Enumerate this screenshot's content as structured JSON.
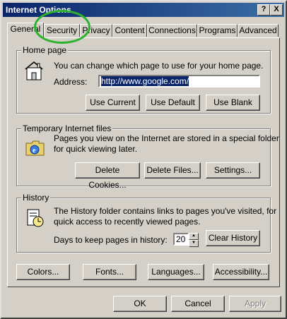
{
  "window": {
    "title": "Internet Options",
    "help_glyph": "?",
    "close_glyph": "X"
  },
  "tabs": [
    {
      "label": "General"
    },
    {
      "label": "Security"
    },
    {
      "label": "Privacy"
    },
    {
      "label": "Content"
    },
    {
      "label": "Connections"
    },
    {
      "label": "Programs"
    },
    {
      "label": "Advanced"
    }
  ],
  "home_page": {
    "title": "Home page",
    "description": "You can change which page to use for your home page.",
    "address_label": "Address:",
    "address_value": "http://www.google.com/",
    "use_current": "Use Current",
    "use_default": "Use Default",
    "use_blank": "Use Blank"
  },
  "temp_files": {
    "title": "Temporary Internet files",
    "description_line1": "Pages you view on the Internet are stored in a special folder",
    "description_line2": "for quick viewing later.",
    "delete_cookies": "Delete Cookies...",
    "delete_files": "Delete Files...",
    "settings": "Settings..."
  },
  "history": {
    "title": "History",
    "description_line1": "The History folder contains links to pages you've visited, for",
    "description_line2": "quick access to recently viewed pages.",
    "days_label": "Days to keep pages in history:",
    "days_value": "20",
    "clear_history": "Clear History"
  },
  "bottom_buttons": {
    "colors": "Colors...",
    "fonts": "Fonts...",
    "languages": "Languages...",
    "accessibility": "Accessibility..."
  },
  "dialog_buttons": {
    "ok": "OK",
    "cancel": "Cancel",
    "apply": "Apply"
  },
  "annotation": {
    "color": "#2cb22c"
  }
}
